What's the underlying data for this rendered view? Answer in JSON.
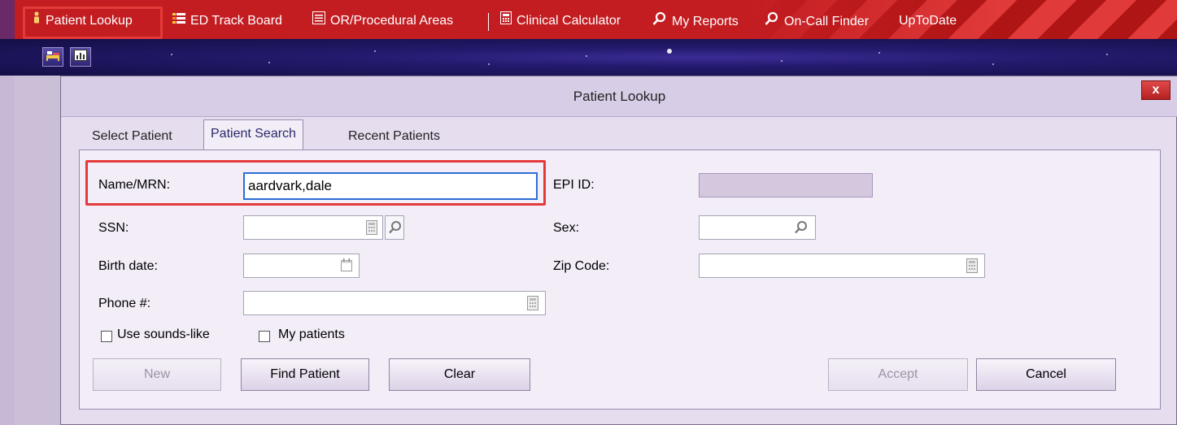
{
  "toolbar": {
    "items": [
      {
        "label": "Patient Lookup",
        "icon": "person-icon"
      },
      {
        "label": "ED Track Board",
        "icon": "trackboard-icon"
      },
      {
        "label": "OR/Procedural Areas",
        "icon": "list-icon"
      },
      {
        "label": "Clinical Calculator",
        "icon": "calculator-icon"
      },
      {
        "label": "My Reports",
        "icon": "search-icon"
      },
      {
        "label": "On-Call Finder",
        "icon": "search-icon"
      },
      {
        "label": "UpToDate",
        "icon": ""
      }
    ]
  },
  "dialog": {
    "title": "Patient Lookup",
    "close_label": "x",
    "tabs": [
      {
        "label": "Select Patient",
        "accel": "S"
      },
      {
        "label": "Patient Search",
        "accel": "P"
      },
      {
        "label": "Recent Patients",
        "accel": "R"
      }
    ],
    "form": {
      "name_mrn_label": "Name/MRN:",
      "name_mrn_value": "aardvark,dale",
      "ssn_label": "SSN:",
      "ssn_value": "",
      "birth_date_label": "Birth date:",
      "birth_date_value": "",
      "phone_label": "Phone #:",
      "phone_value": "",
      "epi_id_label": "EPI ID:",
      "epi_id_value": "",
      "sex_label": "Sex:",
      "sex_value": "",
      "zip_label": "Zip Code:",
      "zip_value": "",
      "use_sounds_like_label": "Use sounds-like",
      "use_sounds_like_checked": false,
      "my_patients_label": "My patients",
      "my_patients_checked": false
    },
    "buttons": {
      "new_label": "New",
      "find_patient_label": "Find Patient",
      "clear_label": "Clear",
      "accept_label": "Accept",
      "cancel_label": "Cancel"
    }
  },
  "colors": {
    "toolbar_red": "#c31d22",
    "highlight_red": "#e53a3a",
    "focus_blue": "#2b6fd6",
    "dialog_bg": "#e6ddef"
  }
}
